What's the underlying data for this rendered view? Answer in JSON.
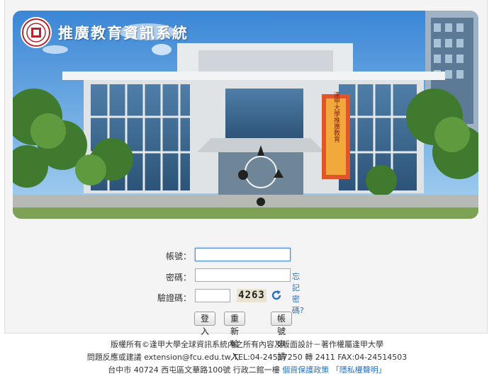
{
  "header": {
    "title": "推廣教育資訊系統",
    "logo_icon": "university-seal-icon"
  },
  "banner": {
    "poster_text": "逢甲大學推廣教育"
  },
  "login": {
    "account_label": "帳號：",
    "password_label": "密碼：",
    "forgot_password": "忘記密碼?",
    "captcha_label": "驗證碼：",
    "captcha_code": "4263",
    "login_button": "登入",
    "reset_button": "重新輸入",
    "apply_button": "帳號申請"
  },
  "footer": {
    "copyright": "版權所有©逢甲大學全球資訊系統內之所有內容及版面設計－著作權屬逢甲大學",
    "contact": "問題反應或建議 extension@fcu.edu.tw TEL:04-24517250 轉 2411 FAX:04-24514503",
    "address": "台中市 40724 西屯區文華路100號 行政二館一樓",
    "privacy_link": "個資保護政策",
    "disclaimer_link": "「隱私權聲明」"
  },
  "colors": {
    "link": "#2a6fc4",
    "focus_border": "#4a90d9"
  }
}
